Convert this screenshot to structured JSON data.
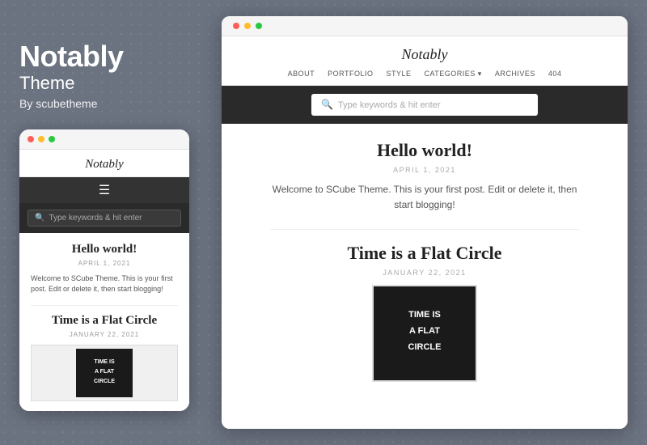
{
  "left": {
    "app_name": "Notably",
    "theme_label": "Theme",
    "by_line": "By scubetheme"
  },
  "mobile": {
    "site_title": "Notably",
    "search_placeholder": "Type keywords & hit enter",
    "post1": {
      "title": "Hello world!",
      "date": "APRIL 1, 2021",
      "excerpt": "Welcome to SCube Theme. This is your first post. Edit or delete it, then start blogging!"
    },
    "post2": {
      "title": "Time is a Flat Circle",
      "date": "JANUARY 22, 2021"
    }
  },
  "desktop": {
    "site_title": "Notably",
    "nav": [
      "ABOUT",
      "PORTFOLIO",
      "STYLE",
      "CATEGORIES ▾",
      "ARCHIVES",
      "404"
    ],
    "search_placeholder": "Type keywords & hit enter",
    "post1": {
      "title": "Hello world!",
      "date": "APRIL 1, 2021",
      "excerpt": "Welcome to SCube Theme. This is your first post. Edit or delete it, then start blogging!"
    },
    "post2": {
      "title": "Time is a Flat Circle",
      "date": "JANUARY 22, 2021",
      "thumbnail_text": "TIME IS\nA FLAT\nCIRCLE"
    }
  },
  "colors": {
    "bg": "#6b7280",
    "dark_nav": "#2a2a2a",
    "accent": "#333"
  }
}
